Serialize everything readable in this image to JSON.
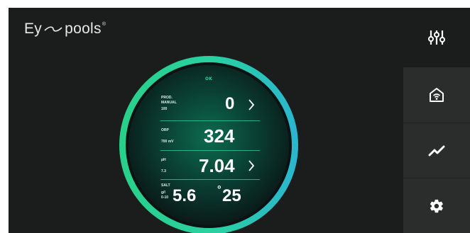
{
  "brand": {
    "name_left": "Ey",
    "name_right": "pools",
    "reg": "®"
  },
  "status": "OK",
  "readings": {
    "prod": {
      "label_1": "PROD.",
      "label_2": "MANUAL",
      "sub": "100",
      "value": "0"
    },
    "orp": {
      "label": "ORP",
      "sub": "700 mV",
      "value": "324"
    },
    "ph": {
      "label": "pH",
      "sub": "7.3",
      "value": "7.04"
    },
    "salt": {
      "label": "SALT",
      "unit": "g/l",
      "sub": "0-10",
      "value": "5.6",
      "temp": "25",
      "temp_unit": "°"
    }
  },
  "side_menu": [
    {
      "name": "settings-sliders",
      "icon": "sliders-icon",
      "active": false
    },
    {
      "name": "home-wifi",
      "icon": "home-wifi-icon",
      "active": true
    },
    {
      "name": "trend",
      "icon": "trend-chart-icon",
      "active": true
    },
    {
      "name": "settings",
      "icon": "gear-icon",
      "active": true
    }
  ],
  "colors": {
    "background": "#1b1c1c",
    "side_panel": "#2b2c2c",
    "ring_start": "#27d18a",
    "ring_end": "#2bb5d0",
    "accent": "#1ed596"
  }
}
